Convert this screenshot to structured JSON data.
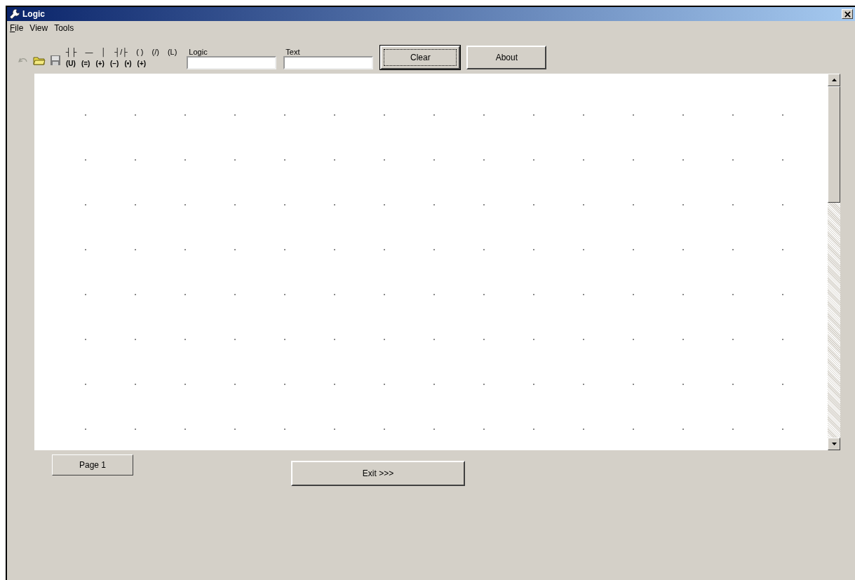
{
  "window": {
    "title": "Logic"
  },
  "menu": [
    {
      "label": "File",
      "mnemonic_underlined": true
    },
    {
      "label": "View",
      "mnemonic_underlined": false
    },
    {
      "label": "Tools",
      "mnemonic_underlined": false
    }
  ],
  "toolbar": {
    "undo_disabled": true,
    "symbols_top": [
      "┤├",
      "—",
      "│",
      "┤/├",
      "( )",
      "(/)",
      "(L)"
    ],
    "symbols_bottom": [
      "(U)",
      "(=)",
      "(+)",
      "(−)",
      "(•)",
      "(+)"
    ]
  },
  "fields": [
    {
      "label": "Logic"
    },
    {
      "label": "Text"
    }
  ],
  "buttons": [
    {
      "label": "Clear",
      "focused": true
    },
    {
      "label": "About",
      "focused": false
    }
  ],
  "page_tabs": [
    {
      "label": "Page 1"
    }
  ],
  "exit_button": {
    "label": "Exit >>>"
  }
}
